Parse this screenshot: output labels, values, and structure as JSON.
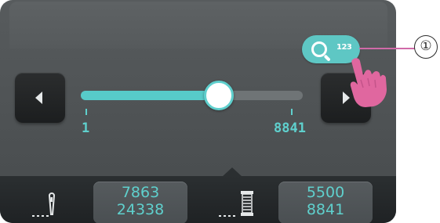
{
  "slider": {
    "min_label": "1",
    "max_label": "8841",
    "min": 1,
    "max": 8841,
    "value": 5500
  },
  "nav": {
    "previous_icon": "chevron-left-icon",
    "next_icon": "chevron-right-icon"
  },
  "search_button": {
    "icon": "search-123-icon",
    "icon_text": "123"
  },
  "callout": {
    "label": "①"
  },
  "status": {
    "stitch_icon": "needle-icon",
    "stitch_current": "7863",
    "stitch_total": "24338",
    "thread_icon": "thread-spool-icon",
    "thread_current": "5500",
    "thread_total": "8841"
  },
  "colors": {
    "accent": "#5ec7c4",
    "pointer": "#e0679f",
    "callout_line": "#d06aa8"
  }
}
